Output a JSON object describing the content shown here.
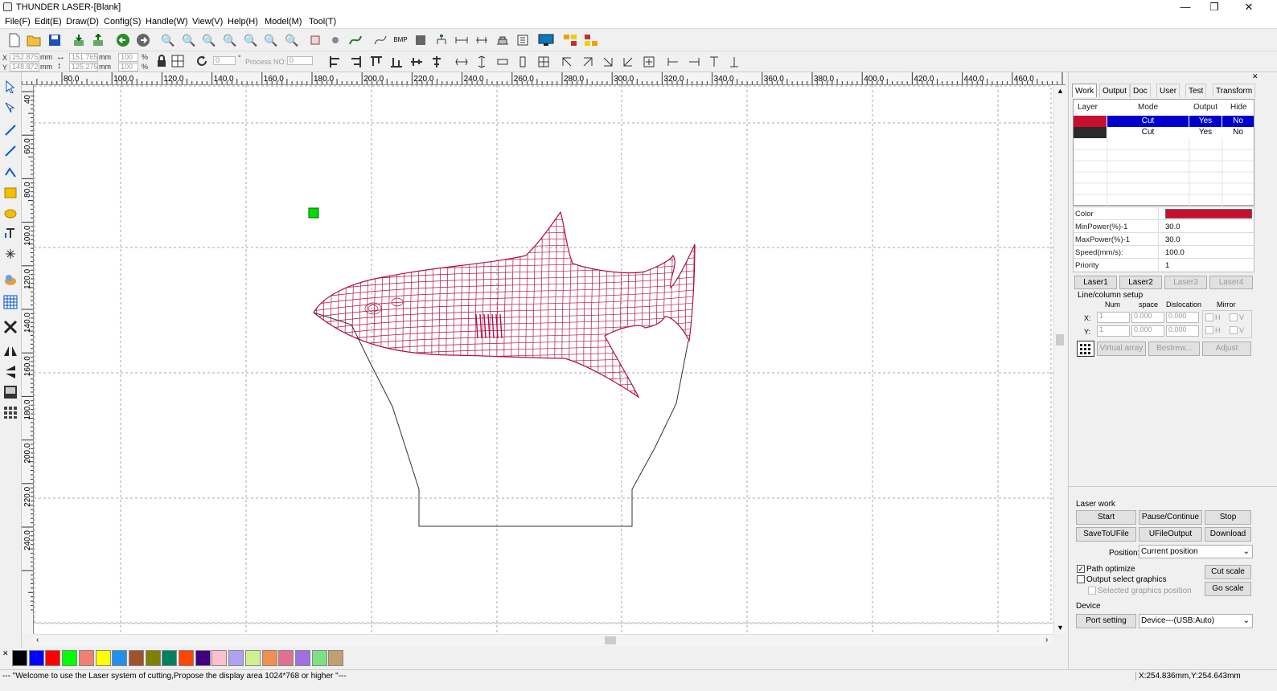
{
  "window": {
    "title": "THUNDER LASER-[Blank]",
    "min": "—",
    "max": "❐",
    "close": "✕"
  },
  "menu": [
    "File(F)",
    "Edit(E)",
    "Draw(D)",
    "Config(S)",
    "Handle(W)",
    "View(V)",
    "Help(H)",
    "Model(M)",
    "Tool(T)"
  ],
  "coords": {
    "x_label": "X",
    "y_label": "Y",
    "x": "252.875",
    "y": "148.872",
    "unit": "mm",
    "w": "151.765",
    "h": "125.275",
    "unit2": "mm",
    "sx": "100",
    "sy": "100",
    "pct": "%",
    "rot": "0",
    "deg": "°",
    "process_label": "Process NO:",
    "process_no": "0"
  },
  "ruler_h": [
    "80.0",
    "100.0",
    "120.0",
    "140.0",
    "160.0",
    "180.0",
    "200.0",
    "220.0",
    "240.0",
    "260.0",
    "280.0",
    "300.0",
    "320.0",
    "340.0",
    "360.0",
    "380.0",
    "400.0",
    "420.0",
    "440.0",
    "460.0"
  ],
  "ruler_v": [
    "40",
    "60.0",
    "80.0",
    "100.0",
    "120.0",
    "140.0",
    "160.0",
    "180.0",
    "200.0",
    "220.0",
    "240.0"
  ],
  "palette": [
    "#000000",
    "#0000ff",
    "#ff0000",
    "#00ff00",
    "#f08070",
    "#ffff00",
    "#2090f0",
    "#a0522d",
    "#808000",
    "#008060",
    "#ff4500",
    "#400080",
    "#ffc0cb",
    "#b0a0f0",
    "#d0f090",
    "#f09050",
    "#e07090",
    "#a070e0",
    "#80e080",
    "#c0a070"
  ],
  "status": {
    "left": "--- \"Welcome to use the Laser system of cutting,Propose the display area 1024*768 or higher \"---",
    "right": "X:254.836mm,Y:254.643mm"
  },
  "panel": {
    "tabs": [
      "Work",
      "Output",
      "Doc",
      "User",
      "Test",
      "Transform"
    ],
    "layer_headers": [
      "Layer",
      "Mode",
      "Output",
      "Hide"
    ],
    "layers": [
      {
        "color": "#c8102e",
        "mode": "Cut",
        "output": "Yes",
        "hide": "No"
      },
      {
        "color": "#2b2b2b",
        "mode": "Cut",
        "output": "Yes",
        "hide": "No"
      }
    ],
    "props": [
      {
        "k": "Color",
        "v": ""
      },
      {
        "k": "MinPower(%)-1",
        "v": "30.0"
      },
      {
        "k": "MaxPower(%)-1",
        "v": "30.0"
      },
      {
        "k": "Speed(mm/s):",
        "v": "100.0"
      },
      {
        "k": "Priority",
        "v": "1"
      }
    ],
    "prop_color": "#c8102e",
    "laser_tabs": [
      "Laser1",
      "Laser2",
      "Laser3",
      "Laser4"
    ],
    "array": {
      "title": "Line/column setup",
      "num": "Num",
      "space": "space",
      "dislocation": "Dislocation",
      "mirror": "Mirror",
      "x": "X:",
      "y": "Y:",
      "xnum": "1",
      "xspace": "0.000",
      "xdis": "0.000",
      "ynum": "1",
      "yspace": "0.000",
      "ydis": "0.000",
      "h": "H",
      "v": "V",
      "virtual": "Virtual array",
      "bestrew": "Bestrew...",
      "adjust": "Adjust"
    },
    "laser_work": {
      "title": "Laser work",
      "start": "Start",
      "pause": "Pause/Continue",
      "stop": "Stop",
      "save": "SaveToUFile",
      "ufile": "UFileOutput",
      "download": "Download",
      "position_label": "Position:",
      "position": "Current position",
      "path_opt": "Path optimize",
      "output_sel": "Output select graphics",
      "sel_pos": "Selected graphics position",
      "cut_scale": "Cut scale",
      "go_scale": "Go scale"
    },
    "device": {
      "title": "Device",
      "port": "Port setting",
      "device": "Device---(USB:Auto)"
    }
  }
}
